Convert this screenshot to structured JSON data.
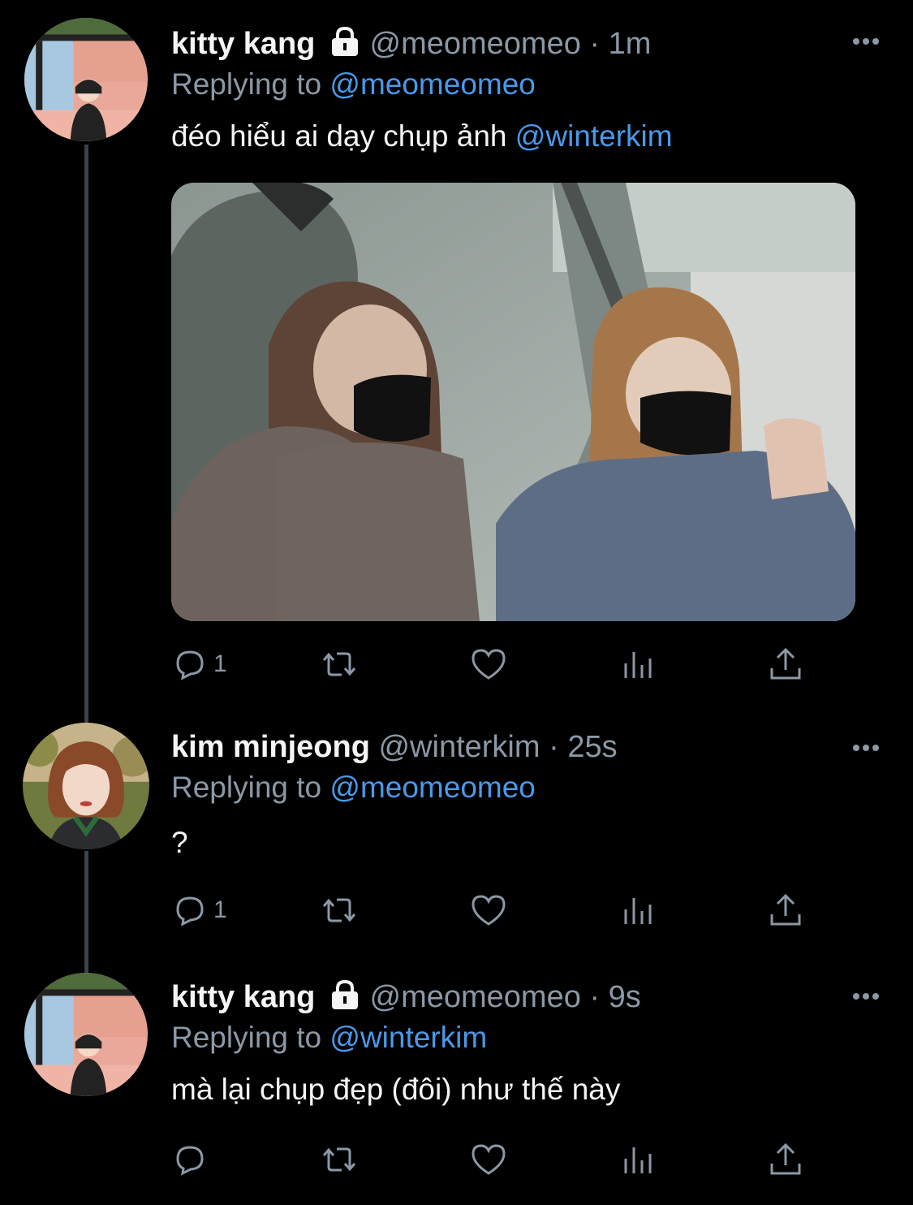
{
  "tweets": [
    {
      "name": "kitty kang",
      "handle": "@meomeomeo",
      "sep": "·",
      "time": "1m",
      "replying_prefix": "Replying to ",
      "replying_to": "@meomeomeo",
      "text": "đéo hiểu ai dạy chụp ảnh ",
      "text_mention": "@winterkim",
      "reply_count": "1"
    },
    {
      "name": "kim minjeong",
      "handle": "@winterkim",
      "sep": "·",
      "time": "25s",
      "replying_prefix": "Replying to ",
      "replying_to": "@meomeomeo",
      "text": "?",
      "reply_count": "1"
    },
    {
      "name": "kitty kang",
      "handle": "@meomeomeo",
      "sep": "·",
      "time": "9s",
      "replying_prefix": "Replying to ",
      "replying_to": "@winterkim",
      "text": "mà lại chụp đẹp (đôi) như thế này",
      "reply_count": ""
    }
  ],
  "icons": {
    "reply": "reply-icon",
    "retweet": "retweet-icon",
    "like": "heart-icon",
    "analytics": "analytics-icon",
    "share": "share-icon",
    "lock": "lock-icon",
    "more": "more-icon"
  },
  "colors": {
    "background": "#000000",
    "name": "#f5f5f5",
    "secondary": "#8b98a5",
    "mention": "#4a99e9",
    "thread_line": "#38444d"
  }
}
